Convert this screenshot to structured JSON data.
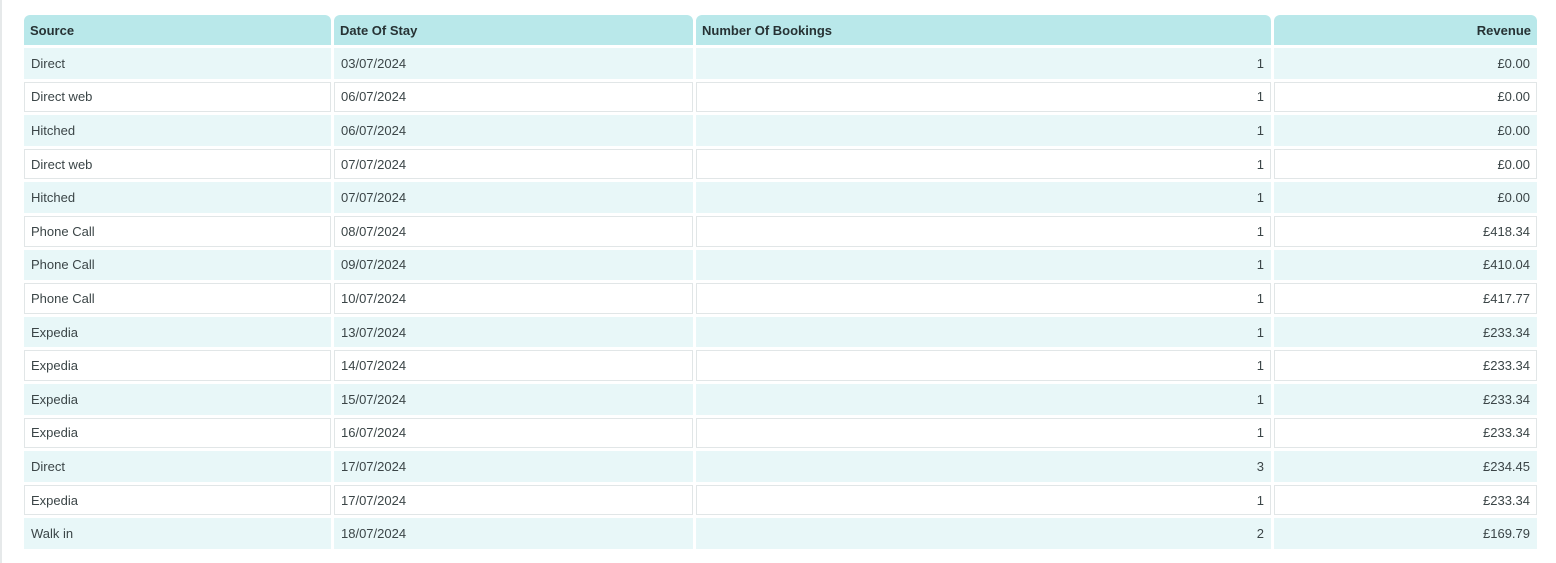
{
  "table": {
    "headers": {
      "source": "Source",
      "date": "Date Of Stay",
      "bookings": "Number Of Bookings",
      "revenue": "Revenue"
    },
    "rows": [
      {
        "source": "Direct",
        "date": "03/07/2024",
        "bookings": "1",
        "revenue": "£0.00"
      },
      {
        "source": "Direct web",
        "date": "06/07/2024",
        "bookings": "1",
        "revenue": "£0.00"
      },
      {
        "source": "Hitched",
        "date": "06/07/2024",
        "bookings": "1",
        "revenue": "£0.00"
      },
      {
        "source": "Direct web",
        "date": "07/07/2024",
        "bookings": "1",
        "revenue": "£0.00"
      },
      {
        "source": "Hitched",
        "date": "07/07/2024",
        "bookings": "1",
        "revenue": "£0.00"
      },
      {
        "source": "Phone Call",
        "date": "08/07/2024",
        "bookings": "1",
        "revenue": "£418.34"
      },
      {
        "source": "Phone Call",
        "date": "09/07/2024",
        "bookings": "1",
        "revenue": "£410.04"
      },
      {
        "source": "Phone Call",
        "date": "10/07/2024",
        "bookings": "1",
        "revenue": "£417.77"
      },
      {
        "source": "Expedia",
        "date": "13/07/2024",
        "bookings": "1",
        "revenue": "£233.34"
      },
      {
        "source": "Expedia",
        "date": "14/07/2024",
        "bookings": "1",
        "revenue": "£233.34"
      },
      {
        "source": "Expedia",
        "date": "15/07/2024",
        "bookings": "1",
        "revenue": "£233.34"
      },
      {
        "source": "Expedia",
        "date": "16/07/2024",
        "bookings": "1",
        "revenue": "£233.34"
      },
      {
        "source": "Direct",
        "date": "17/07/2024",
        "bookings": "3",
        "revenue": "£234.45"
      },
      {
        "source": "Expedia",
        "date": "17/07/2024",
        "bookings": "1",
        "revenue": "£233.34"
      },
      {
        "source": "Walk in",
        "date": "18/07/2024",
        "bookings": "2",
        "revenue": "£169.79"
      }
    ]
  },
  "colors": {
    "header_bg": "#b9e8ea",
    "row_alt_bg": "#e8f7f8",
    "row_bg": "#ffffff"
  }
}
